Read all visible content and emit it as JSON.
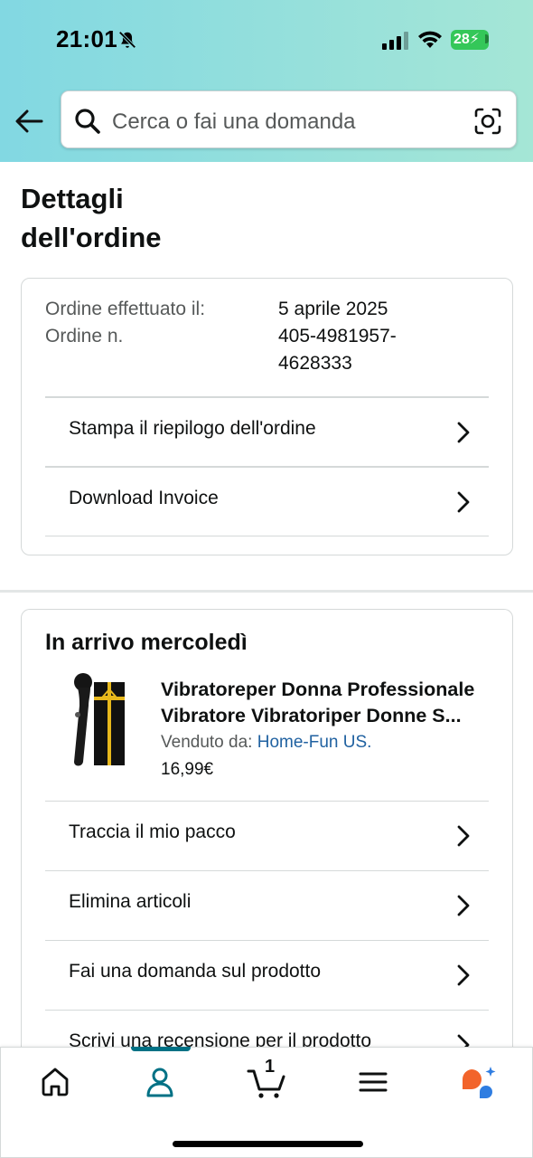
{
  "status_bar": {
    "time": "21:01",
    "battery": "28"
  },
  "search": {
    "placeholder": "Cerca o fai una domanda"
  },
  "page": {
    "title_line1": "Dettagli",
    "title_line2": "dell'ordine"
  },
  "order": {
    "placed_label": "Ordine effettuato il:",
    "placed_value": "5 aprile 2025",
    "number_label": "Ordine n.",
    "number_line1": "405-4981957-",
    "number_line2": "4628333",
    "actions": [
      "Stampa il riepilogo dell'ordine",
      "Download Invoice"
    ]
  },
  "shipment": {
    "title": "In arrivo mercoledì",
    "product": {
      "title_line1": "Vibratoreper Donna Professionale",
      "title_line2": "Vibratore Vibratoriper Donne S...",
      "seller_label": "Venduto da: ",
      "seller_name": "Home-Fun US.",
      "price": "16,99€"
    },
    "actions": [
      "Traccia il mio pacco",
      "Elimina articoli",
      "Fai una domanda sul prodotto",
      "Scrivi una recensione per il prodotto"
    ]
  },
  "tabbar": {
    "cart_count": "1",
    "active_tab": "account",
    "accent_color": "#007185"
  }
}
